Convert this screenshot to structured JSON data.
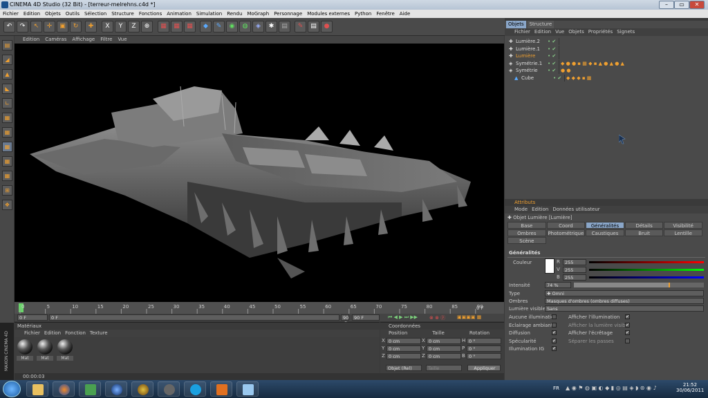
{
  "title": "CINEMA 4D Studio (32 Bit) - [terreur-melrehns.c4d *]",
  "menu": [
    "Fichier",
    "Edition",
    "Objets",
    "Outils",
    "Sélection",
    "Structure",
    "Fonctions",
    "Animation",
    "Simulation",
    "Rendu",
    "MoGraph",
    "Personnage",
    "Modules externes",
    "Python",
    "Fenêtre",
    "Aide"
  ],
  "viewport_menu": [
    "Edition",
    "Caméras",
    "Affichage",
    "Filtre",
    "Vue"
  ],
  "timeline": {
    "ticks": [
      "0",
      "5",
      "10",
      "15",
      "20",
      "25",
      "30",
      "35",
      "40",
      "45",
      "50",
      "55",
      "60",
      "65",
      "70",
      "75",
      "80",
      "85",
      "90"
    ],
    "current": "0 F",
    "start": "0 F",
    "field2": "0 F",
    "end_a": "90 F",
    "end_b": "90 F"
  },
  "materials": {
    "title": "Matériaux",
    "menu": [
      "Fichier",
      "Edition",
      "Fonction",
      "Texture"
    ],
    "items": [
      "Mat",
      "Mat",
      "Mat"
    ]
  },
  "coords": {
    "title": "Coordonnées",
    "cols": [
      "Position",
      "Taille",
      "Rotation"
    ],
    "rows": [
      {
        "a": "X",
        "p": "0 cm",
        "b": "X",
        "s": "0 cm",
        "c": "H",
        "r": "0 °"
      },
      {
        "a": "Y",
        "p": "0 cm",
        "b": "Y",
        "s": "0 cm",
        "c": "P",
        "r": "0 °"
      },
      {
        "a": "Z",
        "p": "0 cm",
        "b": "Z",
        "s": "0 cm",
        "c": "B",
        "r": "0 °"
      }
    ],
    "mode": "Objet (Rel)",
    "size_mode": "Taille",
    "apply": "Appliquer"
  },
  "status_time": "00:00:03",
  "objects": {
    "tabs": [
      "Objets",
      "Structure"
    ],
    "menu": [
      "Fichier",
      "Edition",
      "Vue",
      "Objets",
      "Propriétés",
      "Signets"
    ],
    "rows": [
      {
        "name": "Lumière.2",
        "indent": 0
      },
      {
        "name": "Lumière.1",
        "indent": 0
      },
      {
        "name": "Lumière",
        "indent": 0
      },
      {
        "name": "Symétrie.1",
        "indent": 0
      },
      {
        "name": "Symétrie",
        "indent": 0
      },
      {
        "name": "Cube",
        "indent": 1
      }
    ]
  },
  "attributes": {
    "title": "Attributs",
    "menu": [
      "Mode",
      "Edition",
      "Données utilisateur"
    ],
    "object": "Objet Lumière [Lumière]",
    "tabs": [
      "Base",
      "Coord",
      "Généralités",
      "Détails",
      "Visibilité",
      "Ombres",
      "Photométrique",
      "Caustiques",
      "Bruit",
      "Lentille",
      "Scène"
    ],
    "section": "Généralités",
    "color_label": "Couleur",
    "r_label": "R",
    "v_label": "V",
    "b_label": "B",
    "r": "255",
    "v": "255",
    "b": "255",
    "intensity_label": "Intensité",
    "intensity": "74 %",
    "intensity_level": 0.74,
    "type_label": "Type",
    "type": "Omni",
    "shadows_label": "Ombres",
    "shadows": "Masques d'ombres (ombres diffuses)",
    "visible_label": "Lumière visible",
    "visible": "Sans",
    "checks_left": [
      "Aucune illumination",
      "Eclairage ambiant",
      "Diffusion",
      "Spécularité",
      "Illumination IG"
    ],
    "checks_right": [
      "Afficher l'illumination",
      "Afficher la lumière visible",
      "Afficher l'écrêtage",
      "Séparer les passes"
    ]
  },
  "taskbar": {
    "lang": "FR",
    "time": "21:52",
    "date": "30/06/2011"
  },
  "colors": {
    "accent": "#f0a030",
    "active_tab": "#8aa6c8"
  }
}
